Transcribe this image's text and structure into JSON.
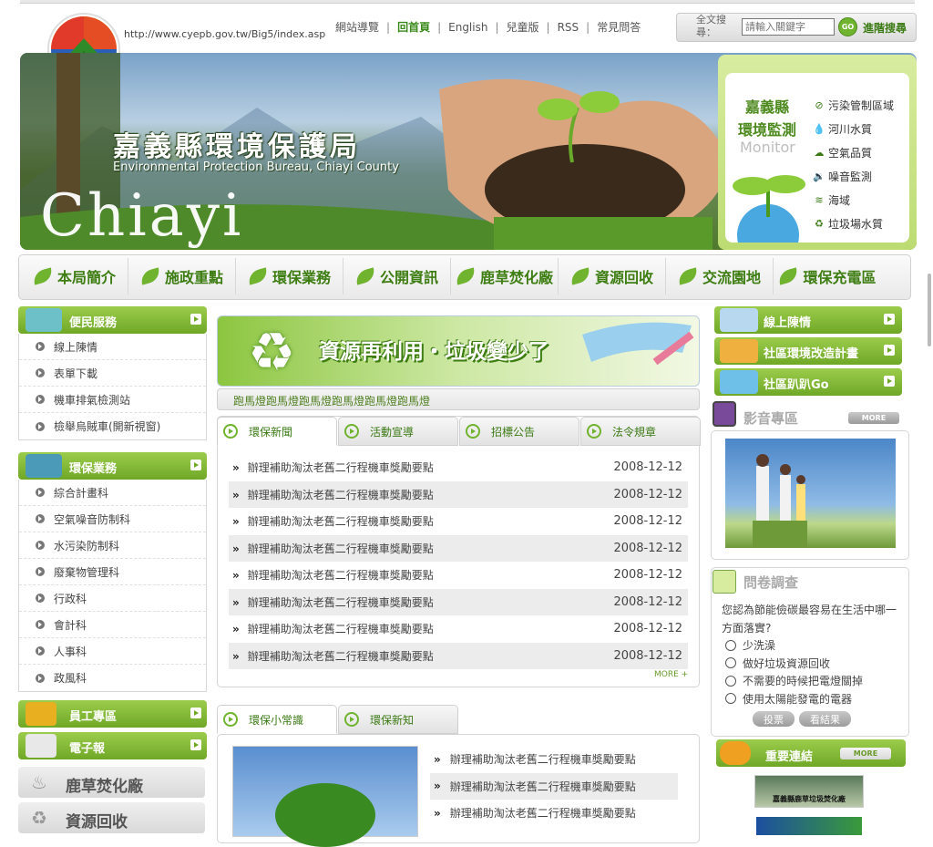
{
  "site": {
    "url": "http://www.cyepb.gov.tw/Big5/index.asp"
  },
  "topnav": {
    "items": [
      "網站導覽",
      "回首頁",
      "English",
      "兒童版",
      "RSS",
      "常見問答"
    ]
  },
  "search": {
    "label": "全文搜尋：",
    "placeholder": "請輸入關鍵字",
    "go_label": "GO",
    "advanced": "進階搜尋"
  },
  "banner": {
    "title": "嘉義縣環境保護局",
    "subtitle": "Environmental Protection Bureau, Chiayi County",
    "watermark": "Chiayi"
  },
  "monitor": {
    "title1": "嘉義縣",
    "title2": "環境監測",
    "title3": "Monitor",
    "items": [
      {
        "icon": "prohibit-icon",
        "glyph": "⊘",
        "label": "污染管制區域"
      },
      {
        "icon": "water-drop-icon",
        "glyph": "💧",
        "label": "河川水質"
      },
      {
        "icon": "cloud-icon",
        "glyph": "☁",
        "label": "空氣品質"
      },
      {
        "icon": "speaker-icon",
        "glyph": "🔉",
        "label": "噪音監測"
      },
      {
        "icon": "wave-icon",
        "glyph": "≋",
        "label": "海域"
      },
      {
        "icon": "recycle-icon",
        "glyph": "♻",
        "label": "垃圾場水質"
      }
    ]
  },
  "menu": {
    "items": [
      "本局簡介",
      "施政重點",
      "環保業務",
      "公開資訊",
      "鹿草焚化廠",
      "資源回收",
      "交流園地",
      "環保充電區"
    ]
  },
  "left": {
    "service": {
      "title": "便民服務",
      "items": [
        "線上陳情",
        "表單下載",
        "機車排氣檢測站",
        "檢舉烏賊車(開新視窗)"
      ]
    },
    "business": {
      "title": "環保業務",
      "items": [
        "綜合計畫科",
        "空氣噪音防制科",
        "水污染防制科",
        "廢棄物管理科",
        "行政科",
        "會計科",
        "人事科",
        "政風科"
      ]
    },
    "staff": "員工專區",
    "enews": "電子報",
    "incinerator": "鹿草焚化廠",
    "recycle": "資源回收"
  },
  "center": {
    "recycle_banner": "資源再利用・垃圾變少了",
    "marquee": "跑馬燈跑馬燈跑馬燈跑馬燈跑馬燈跑馬燈",
    "news_tabs": [
      "環保新聞",
      "活動宣導",
      "招標公告",
      "法令規章"
    ],
    "news": [
      {
        "title": "辦理補助淘汰老舊二行程機車獎勵要點",
        "date": "2008-12-12"
      },
      {
        "title": "辦理補助淘汰老舊二行程機車獎勵要點",
        "date": "2008-12-12"
      },
      {
        "title": "辦理補助淘汰老舊二行程機車獎勵要點",
        "date": "2008-12-12"
      },
      {
        "title": "辦理補助淘汰老舊二行程機車獎勵要點",
        "date": "2008-12-12"
      },
      {
        "title": "辦理補助淘汰老舊二行程機車獎勵要點",
        "date": "2008-12-12"
      },
      {
        "title": "辦理補助淘汰老舊二行程機車獎勵要點",
        "date": "2008-12-12"
      },
      {
        "title": "辦理補助淘汰老舊二行程機車獎勵要點",
        "date": "2008-12-12"
      },
      {
        "title": "辦理補助淘汰老舊二行程機車獎勵要點",
        "date": "2008-12-12"
      }
    ],
    "more": "MORE +",
    "tip_tabs": [
      "環保小常識",
      "環保新知"
    ],
    "tips": [
      "辦理補助淘汰老舊二行程機車獎勵要點",
      "辦理補助淘汰老舊二行程機車獎勵要點",
      "辦理補助淘汰老舊二行程機車獎勵要點"
    ]
  },
  "right": {
    "buttons": [
      "線上陳情",
      "社區環境改造計畫",
      "社區趴趴Go"
    ],
    "video": {
      "title": "影音專區",
      "more": "MORE"
    },
    "poll": {
      "title": "問卷調查",
      "question": "您認為節能儉碳最容易在生活中哪一方面落實?",
      "options": [
        "少洗澡",
        "做好垃圾資源回收",
        "不需要的時候把電燈關掉",
        "使用太陽能發電的電器"
      ],
      "vote": "投票",
      "results": "看結果"
    },
    "links": {
      "title": "重要連結",
      "more": "MORE",
      "link1": "嘉義縣鹿草垃圾焚化廠",
      "link2": ""
    }
  },
  "colors": {
    "brand_green": "#6fa826",
    "light_green": "#9ccc4c",
    "text_green": "#3d7d12"
  }
}
